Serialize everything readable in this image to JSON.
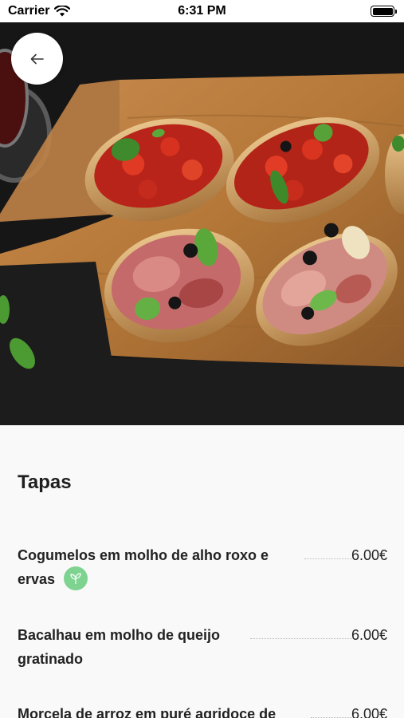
{
  "status_bar": {
    "carrier": "Carrier",
    "time": "6:31 PM",
    "battery_level": 1.0
  },
  "hero": {
    "image": "bruschetta-platter",
    "back_icon": "arrow-left-icon"
  },
  "menu": {
    "section_title": "Tapas",
    "items": [
      {
        "name_line1": "Cogumelos em molho de alho roxo e",
        "name_line2": "ervas",
        "price": "6.00€",
        "vegetarian": true,
        "badge_icon": "sprout-icon"
      },
      {
        "name_line1": "Bacalhau em molho de queijo",
        "name_line2": "gratinado",
        "price": "6.00€",
        "vegetarian": false
      },
      {
        "name_line1": "Morcela de arroz em puré agridoce de",
        "price": "6.00€",
        "vegetarian": false
      }
    ]
  },
  "colors": {
    "veg_badge": "#7dd38f",
    "background": "#f9f9f9",
    "text": "#222222"
  }
}
